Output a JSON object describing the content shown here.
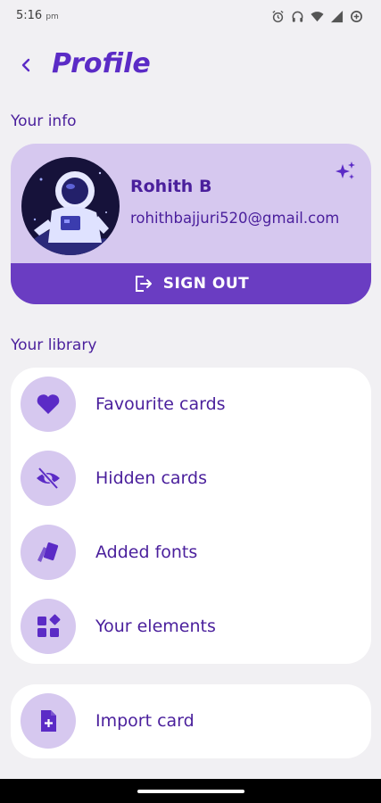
{
  "status_bar": {
    "time": "5:16",
    "ampm": "pm",
    "icons": [
      "alarm-icon",
      "headphones-icon",
      "wifi-icon",
      "signal-icon",
      "data-saver-icon"
    ]
  },
  "header": {
    "back_icon": "back-chevron-icon",
    "title": "Profile"
  },
  "your_info": {
    "section_label": "Your info",
    "name": "Rohith B",
    "email": "rohithbajjuri520@gmail.com",
    "edit_icon": "sparkle-icon",
    "sign_out_label": "SIGN OUT",
    "sign_out_icon": "logout-icon"
  },
  "your_library": {
    "section_label": "Your library",
    "items": [
      {
        "label": "Favourite cards",
        "icon": "heart-icon"
      },
      {
        "label": "Hidden cards",
        "icon": "eye-off-icon"
      },
      {
        "label": "Added fonts",
        "icon": "font-cards-icon"
      },
      {
        "label": "Your elements",
        "icon": "shapes-icon"
      }
    ]
  },
  "import": {
    "label": "Import card",
    "icon": "file-add-icon"
  },
  "colors": {
    "background": "#f1f0f3",
    "accent": "#5b2bc6",
    "text": "#4a1f9c",
    "card_tint": "#d6c8ef",
    "sign_out_bar": "#6a3dc2"
  }
}
